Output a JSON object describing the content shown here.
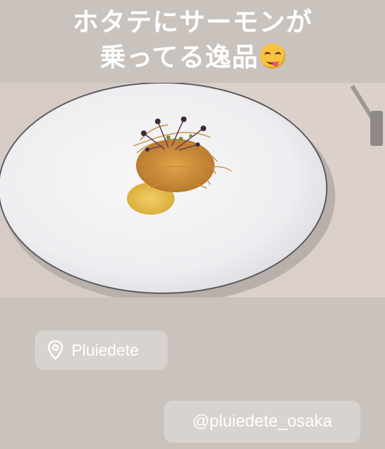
{
  "caption": {
    "line1": "ホタテにサーモンが",
    "line2": "乗ってる逸品",
    "emoji": "savoring-face-emoji"
  },
  "photo": {
    "subject": "plated-dish-photo"
  },
  "location_sticker": {
    "icon": "location-pin-icon",
    "label": "Pluiedete"
  },
  "mention_sticker": {
    "label": "@pluiedete_osaka"
  },
  "colors": {
    "background": "#c9c2bd",
    "sticker_bg": "#e6e2df",
    "plate": "#f1f1f3",
    "sauce": "#e9c35a"
  }
}
